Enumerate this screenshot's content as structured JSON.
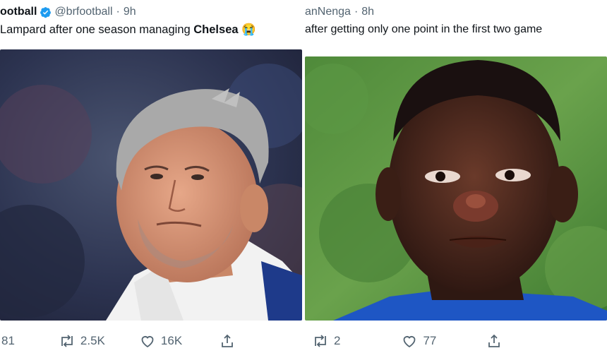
{
  "left_tweet": {
    "account_name": "ootball",
    "handle": "@brfootball",
    "separator": "·",
    "time": "9h",
    "text_before": "Lampard after one season managing ",
    "text_bold": "Chelsea",
    "emoji": "😭",
    "actions": {
      "replies": "81",
      "retweets": "2.5K",
      "likes": "16K"
    }
  },
  "right_tweet": {
    "account_name": "anNenga",
    "separator": "·",
    "time": "8h",
    "text": "after getting only one point in the first two game",
    "actions": {
      "retweets": "2",
      "likes": "77"
    }
  },
  "colors": {
    "text": "#0f1419",
    "muted": "#536471",
    "verified": "#1d9bf0"
  }
}
